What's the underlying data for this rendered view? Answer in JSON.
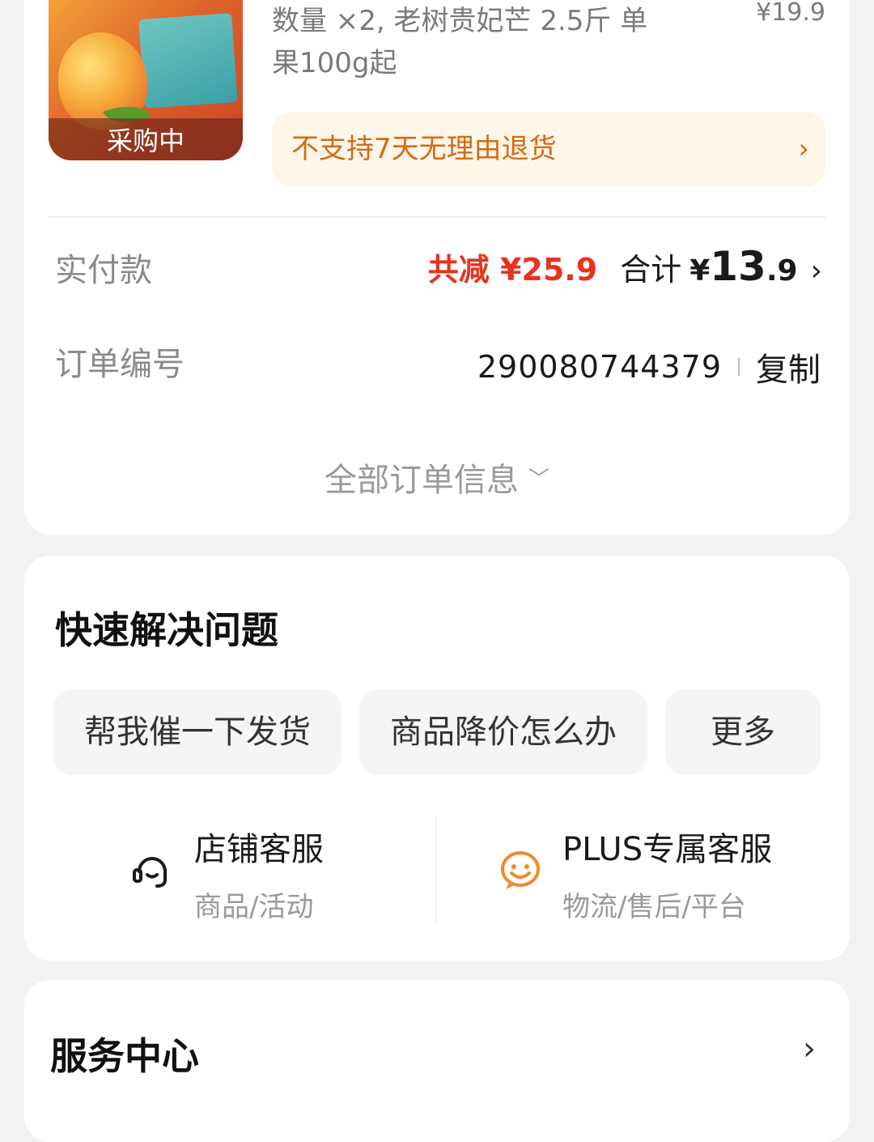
{
  "product": {
    "thumb_label": "采购中",
    "desc": "数量 ×2, 老树贵妃芒 2.5斤 单果100g起",
    "price": "¥19.9",
    "return_policy": "不支持7天无理由退货"
  },
  "payment": {
    "label": "实付款",
    "discount": "共减 ¥25.9",
    "total_label": "合计",
    "currency": "¥",
    "total_int": "13",
    "total_dec": ".9"
  },
  "order": {
    "label": "订单编号",
    "number": "290080744379",
    "copy_label": "复制",
    "all_info_label": "全部订单信息"
  },
  "quick": {
    "title": "快速解决问题",
    "chips": [
      "帮我催一下发货",
      "商品降价怎么办",
      "更多"
    ],
    "store_service": {
      "name": "店铺客服",
      "sub": "商品/活动"
    },
    "plus_service": {
      "name": "PLUS专属客服",
      "sub": "物流/售后/平台"
    }
  },
  "service_center": {
    "title": "服务中心"
  },
  "icons": {
    "headset": "headset-icon",
    "smiley": "smiley-icon",
    "chevron_right": "chevron-right-icon",
    "chevron_down": "chevron-down-icon"
  },
  "colors": {
    "discount_red": "#e8321f",
    "return_orange": "#d46a12",
    "plus_icon_orange": "#f08a2a"
  }
}
